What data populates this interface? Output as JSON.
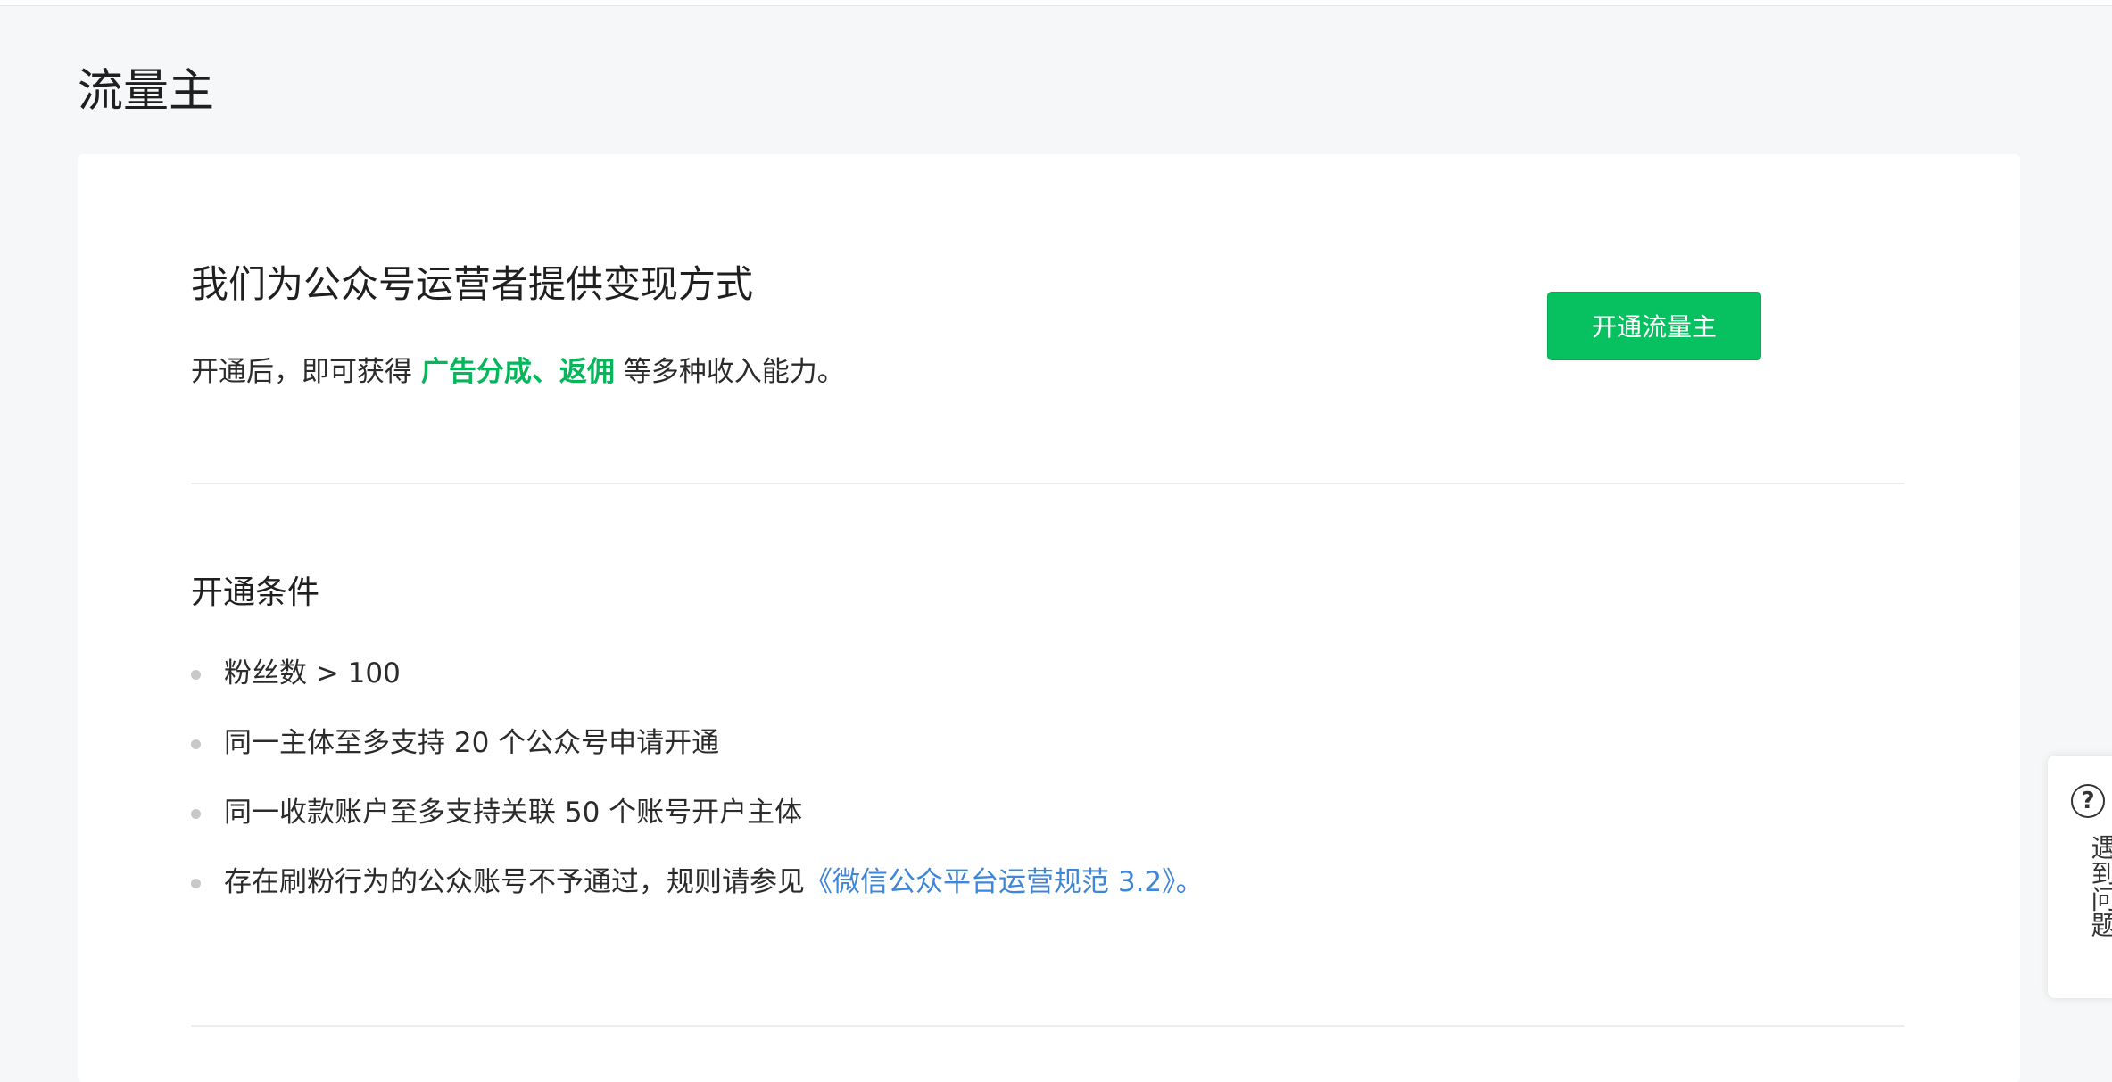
{
  "page": {
    "title": "流量主"
  },
  "intro": {
    "title": "我们为公众号运营者提供变现方式",
    "desc_prefix": "开通后，即可获得 ",
    "desc_highlight": "广告分成、返佣",
    "desc_suffix": " 等多种收入能力。",
    "open_button_label": "开通流量主"
  },
  "conditions": {
    "title": "开通条件",
    "items": [
      {
        "text": "粉丝数 > 100"
      },
      {
        "text": "同一主体至多支持 20 个公众号申请开通"
      },
      {
        "text": "同一收款账户至多支持关联 50 个账号开户主体"
      },
      {
        "text": "存在刷粉行为的公众账号不予通过，规则请参见",
        "link": "《微信公众平台运营规范 3.2》",
        "suffix": "。"
      }
    ]
  },
  "help": {
    "icon": "question-circle-icon",
    "icon_glyph": "?",
    "label": "遇到问题"
  },
  "colors": {
    "accent": "#07c160",
    "highlight": "#07b55a",
    "link": "#3e86d8",
    "background": "#f6f7f8"
  }
}
